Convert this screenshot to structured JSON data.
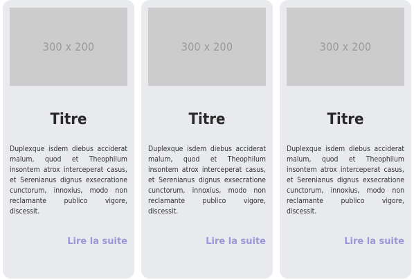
{
  "cards": [
    {
      "image_text": "300 x 200",
      "title": "Titre",
      "text": "Duplexque isdem diebus acciderat malum, quod et Theophilum insontem atrox interceperat casus, et Serenianus dignus exsecratione cunctorum, innoxius, modo non reclamante publico vigore, discessit.",
      "link": "Lire la suite"
    },
    {
      "image_text": "300 x 200",
      "title": "Titre",
      "text": "Duplexque isdem diebus acciderat malum, quod et Theophilum insontem atrox interceperat casus, et Serenianus dignus exsecratione cunctorum, innoxius, modo non reclamante publico vigore, discessit.",
      "link": "Lire la suite"
    },
    {
      "image_text": "300 x 200",
      "title": "Titre",
      "text": "Duplexque isdem diebus acciderat malum, quod et Theophilum insontem atrox interceperat casus, et Serenianus dignus exsecratione cunctorum, innoxius, modo non reclamante publico vigore, discessit.",
      "link": "Lire la suite"
    }
  ],
  "colors": {
    "card_background": "#e9eaed",
    "placeholder_background": "#cccccc",
    "placeholder_text": "#999999",
    "link": "#9a98d8"
  }
}
